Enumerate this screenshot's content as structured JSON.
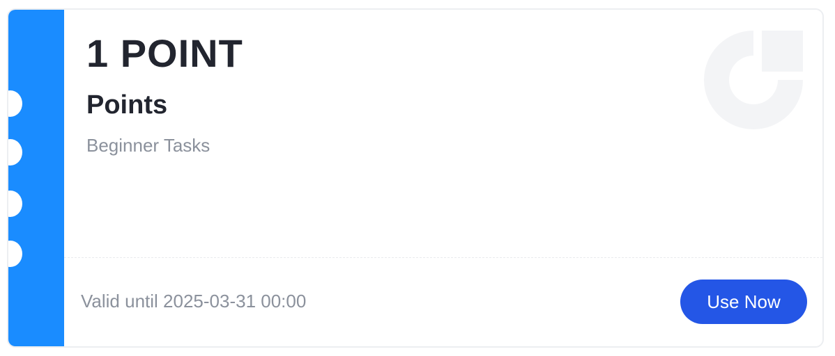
{
  "coupon": {
    "amount": "1 POINT",
    "type": "Points",
    "source": "Beginner Tasks",
    "validity": "Valid until 2025-03-31 00:00",
    "action_label": "Use Now",
    "watermark_icon": "brand-logo-icon"
  },
  "colors": {
    "stripe": "#1a8cff",
    "button": "#2456e6",
    "title_text": "#22252f",
    "secondary_text": "#8b919c",
    "watermark": "#f3f4f6"
  }
}
